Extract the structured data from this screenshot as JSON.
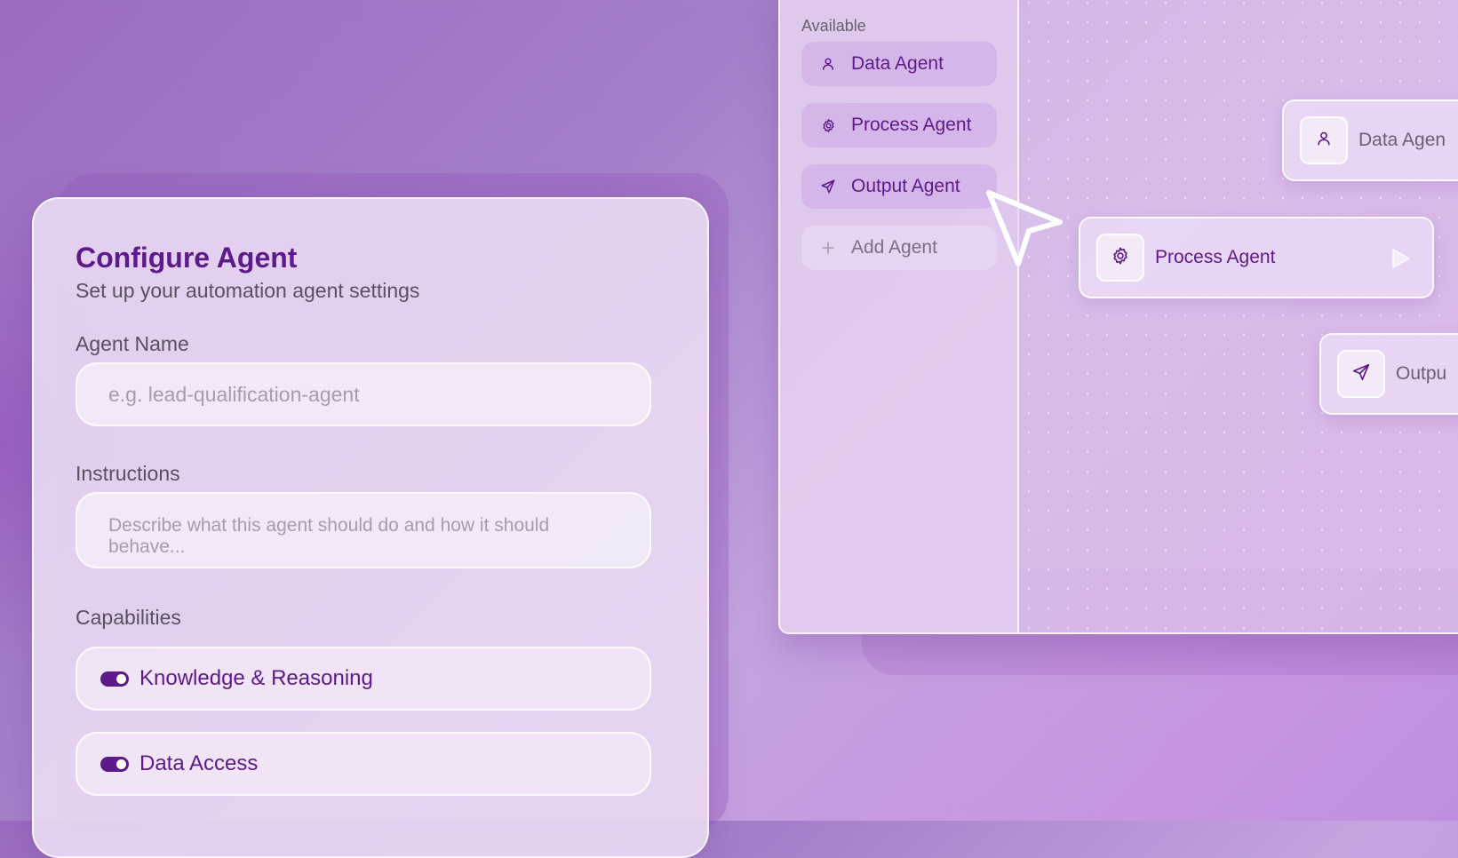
{
  "config": {
    "title": "Configure Agent",
    "subtitle": "Set up your automation agent settings",
    "agent_name": {
      "label": "Agent Name",
      "placeholder": "e.g. lead-qualification-agent",
      "value": ""
    },
    "instructions": {
      "label": "Instructions",
      "placeholder": "Describe what this agent should do and how it should behave...",
      "value": ""
    },
    "capabilities": {
      "label": "Capabilities",
      "items": [
        {
          "label": "Knowledge & Reasoning",
          "enabled": true
        },
        {
          "label": "Data Access",
          "enabled": true
        }
      ]
    }
  },
  "sidebar": {
    "heading": "Available",
    "items": [
      {
        "label": "Data Agent",
        "icon": "user-icon"
      },
      {
        "label": "Process Agent",
        "icon": "gear-icon"
      },
      {
        "label": "Output Agent",
        "icon": "send-icon"
      },
      {
        "label": "Add Agent",
        "icon": "plus-icon"
      }
    ]
  },
  "canvas": {
    "nodes": [
      {
        "label": "Data Agen",
        "icon": "user-icon"
      },
      {
        "label": "Process Agent",
        "icon": "gear-icon",
        "action_icon": "play-icon"
      },
      {
        "label": "Outpu",
        "icon": "send-icon"
      }
    ]
  },
  "colors": {
    "accent": "#5c1a8a",
    "muted_text": "#5a5160",
    "placeholder": "#a79cae"
  }
}
